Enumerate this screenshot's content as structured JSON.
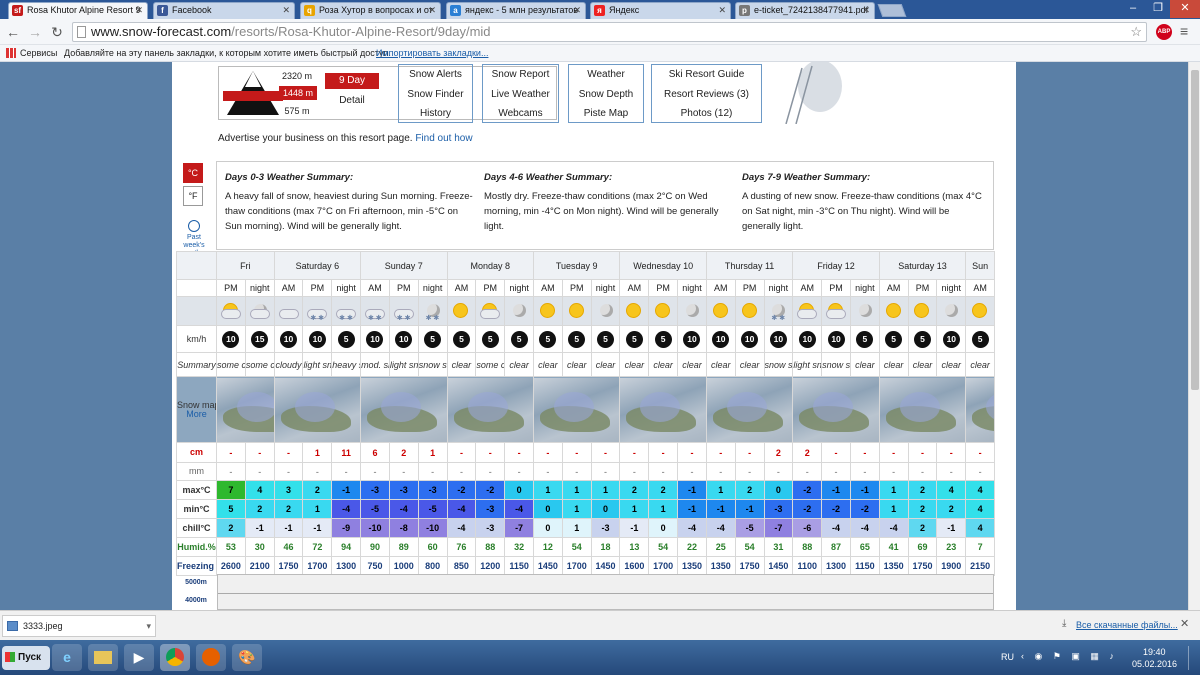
{
  "tabs": [
    {
      "label": "Rosa Khutor Alpine Resort 9",
      "icon": "sf",
      "color": "#c41a1a"
    },
    {
      "label": "Facebook",
      "icon": "f",
      "color": "#3b5998"
    },
    {
      "label": "Роза Хутор в вопросах и от",
      "icon": "q",
      "color": "#e8a400"
    },
    {
      "label": "яндекс - 5 млн результатов",
      "icon": "a",
      "color": "#2a7fd4"
    },
    {
      "label": "Яндекс",
      "icon": "я",
      "color": "#e22"
    },
    {
      "label": "e-ticket_7242138477941.pdf",
      "icon": "p",
      "color": "#777"
    }
  ],
  "address": {
    "host": "www.snow-forecast.com",
    "path": "/resorts/Rosa-Khutor-Alpine-Resort/9day/mid"
  },
  "bookmarks": {
    "apps": "Сервисы",
    "hint": "Добавляйте на эту панель закладки, к которым хотите иметь быстрый доступ.",
    "import": "Импортировать закладки..."
  },
  "resort": {
    "top": "2320 m",
    "mid": "1448 m",
    "bot": "575 m",
    "nine_day": "9 Day",
    "detail": "Detail"
  },
  "links": [
    [
      "Snow Alerts",
      "Snow Finder",
      "History"
    ],
    [
      "Snow Report",
      "Live Weather",
      "Webcams"
    ],
    [
      "Weather",
      "Snow Depth",
      "Piste Map"
    ],
    [
      "Ski Resort Guide",
      "Resort Reviews (3)",
      "Photos (12)"
    ]
  ],
  "advert": {
    "text": "Advertise your business on this resort page.",
    "link": "Find out how"
  },
  "units": {
    "c": "°C",
    "f": "°F",
    "past": "Past week's weather"
  },
  "summary": [
    {
      "title": "Days 0-3 Weather Summary:",
      "text": "A heavy fall of snow, heaviest during Sun morning. Freeze-thaw conditions (max 7°C on Fri afternoon, min -5°C on Sun morning). Wind will be generally light."
    },
    {
      "title": "Days 4-6 Weather Summary:",
      "text": "Mostly dry. Freeze-thaw conditions (max 2°C on Wed morning, min -4°C on Mon night). Wind will be generally light."
    },
    {
      "title": "Days 7-9 Weather Summary:",
      "text": "A dusting of new snow. Freeze-thaw conditions (max 4°C on Sat night, min -3°C on Thu night). Wind will be generally light."
    }
  ],
  "labels": {
    "wind": "km/h",
    "summary": "Summary",
    "snowmap": "Snow map",
    "more": "More",
    "snow": "cm",
    "rain": "mm",
    "max": "max°C",
    "min": "min°C",
    "chill": "chill°C",
    "hum": "Humid.%",
    "frz": "Freezing level (m)",
    "alt1": "5000m",
    "alt2": "4000m"
  },
  "days": [
    {
      "name": "Fri",
      "span": 2
    },
    {
      "name": "Saturday 6",
      "span": 3
    },
    {
      "name": "Sunday 7",
      "span": 3
    },
    {
      "name": "Monday 8",
      "span": 3
    },
    {
      "name": "Tuesday 9",
      "span": 3
    },
    {
      "name": "Wednesday 10",
      "span": 3
    },
    {
      "name": "Thursday 11",
      "span": 3
    },
    {
      "name": "Friday 12",
      "span": 3
    },
    {
      "name": "Saturday 13",
      "span": 3
    },
    {
      "name": "Sun",
      "span": 1
    }
  ],
  "periods": [
    "PM",
    "night",
    "AM",
    "PM",
    "night",
    "AM",
    "PM",
    "night",
    "AM",
    "PM",
    "night",
    "AM",
    "PM",
    "night",
    "AM",
    "PM",
    "night",
    "AM",
    "PM",
    "night",
    "AM",
    "PM",
    "night",
    "AM",
    "PM",
    "night",
    "AM"
  ],
  "icons": [
    "sun-cloud",
    "moon-cloud",
    "cloud",
    "cloud-snow",
    "cloud-snow",
    "cloud-snow",
    "cloud-snow",
    "moon-snow",
    "sun",
    "sun-cloud",
    "moon",
    "sun",
    "sun",
    "moon",
    "sun",
    "sun",
    "moon",
    "sun",
    "sun",
    "moon-snow",
    "sun-cloud",
    "sun-cloud",
    "moon",
    "sun",
    "sun",
    "moon",
    "sun"
  ],
  "wind": [
    "10",
    "15",
    "10",
    "10",
    "5",
    "10",
    "10",
    "5",
    "5",
    "5",
    "5",
    "5",
    "5",
    "5",
    "5",
    "5",
    "10",
    "10",
    "10",
    "10",
    "10",
    "10",
    "5",
    "5",
    "5",
    "10",
    "5"
  ],
  "summaries": [
    "some clouds",
    "some clouds",
    "cloudy",
    "light snow",
    "heavy snow",
    "mod. snow",
    "light snow",
    "snow shwrs",
    "clear",
    "some clouds",
    "clear",
    "clear",
    "clear",
    "clear",
    "clear",
    "clear",
    "clear",
    "clear",
    "clear",
    "snow shwrs",
    "light snow",
    "snow shwrs",
    "clear",
    "clear",
    "clear",
    "clear",
    "clear"
  ],
  "snow": [
    "-",
    "-",
    "-",
    "1",
    "11",
    "6",
    "2",
    "1",
    "-",
    "-",
    "-",
    "-",
    "-",
    "-",
    "-",
    "-",
    "-",
    "-",
    "-",
    "2",
    "2",
    "-",
    "-",
    "-",
    "-",
    "-",
    "-"
  ],
  "rain": [
    "-",
    "-",
    "-",
    "-",
    "-",
    "-",
    "-",
    "-",
    "-",
    "-",
    "-",
    "-",
    "-",
    "-",
    "-",
    "-",
    "-",
    "-",
    "-",
    "-",
    "-",
    "-",
    "-",
    "-",
    "-",
    "-",
    "-"
  ],
  "max": [
    "7",
    "4",
    "3",
    "2",
    "-1",
    "-3",
    "-3",
    "-3",
    "-2",
    "-2",
    "0",
    "1",
    "1",
    "1",
    "2",
    "2",
    "-1",
    "1",
    "2",
    "0",
    "-2",
    "-1",
    "-1",
    "1",
    "2",
    "4",
    "4"
  ],
  "min": [
    "5",
    "2",
    "2",
    "1",
    "-4",
    "-5",
    "-4",
    "-5",
    "-4",
    "-3",
    "-4",
    "0",
    "1",
    "0",
    "1",
    "1",
    "-1",
    "-1",
    "-1",
    "-3",
    "-2",
    "-2",
    "-2",
    "1",
    "2",
    "2",
    "4"
  ],
  "chill": [
    "2",
    "-1",
    "-1",
    "-1",
    "-9",
    "-10",
    "-8",
    "-10",
    "-4",
    "-3",
    "-7",
    "0",
    "1",
    "-3",
    "-1",
    "0",
    "-4",
    "-4",
    "-5",
    "-7",
    "-6",
    "-4",
    "-4",
    "-4",
    "2",
    "-1",
    "4"
  ],
  "humidity": [
    "53",
    "30",
    "46",
    "72",
    "94",
    "90",
    "89",
    "60",
    "76",
    "88",
    "32",
    "12",
    "54",
    "18",
    "13",
    "54",
    "22",
    "25",
    "54",
    "31",
    "88",
    "87",
    "65",
    "41",
    "69",
    "23",
    "7"
  ],
  "freezing": [
    "2600",
    "2100",
    "1750",
    "1700",
    "1300",
    "750",
    "1000",
    "800",
    "850",
    "1200",
    "1150",
    "1450",
    "1700",
    "1450",
    "1600",
    "1700",
    "1350",
    "1350",
    "1750",
    "1450",
    "1100",
    "1300",
    "1150",
    "1350",
    "1750",
    "1900",
    "2150"
  ],
  "download": {
    "file": "3333.jpeg",
    "all": "Все скачанные файлы..."
  },
  "taskbar": {
    "start": "Пуск",
    "lang": "RU",
    "time": "19:40",
    "date": "05.02.2016"
  }
}
